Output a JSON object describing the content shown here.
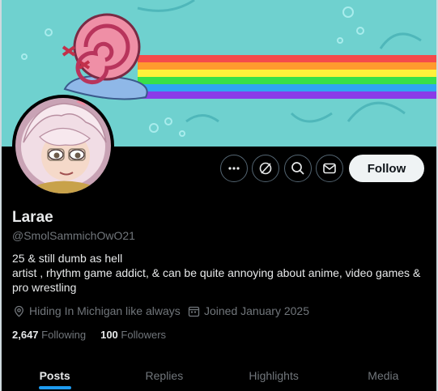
{
  "profile": {
    "display_name": "Larae",
    "handle": "@SmolSammichOwO21",
    "bio_line1": "25 & still dumb as hell",
    "bio_line2": "artist , rhythm game addict, & can be quite annoying about anime, video games & pro wrestling",
    "location": "Hiding In Michigan like always",
    "joined": "Joined January 2025"
  },
  "stats": {
    "following_count": "2,647",
    "following_label": "Following",
    "followers_count": "100",
    "followers_label": "Followers"
  },
  "actions": {
    "follow_label": "Follow",
    "more_icon": "more-icon",
    "grok_icon": "grok-icon",
    "search_icon": "search-icon",
    "message_icon": "message-icon"
  },
  "tabs": [
    {
      "label": "Posts",
      "active": true
    },
    {
      "label": "Replies",
      "active": false
    },
    {
      "label": "Highlights",
      "active": false
    },
    {
      "label": "Media",
      "active": false
    }
  ],
  "colors": {
    "background": "#000000",
    "primary_text": "#e7e9ea",
    "secondary_text": "#71767b",
    "accent": "#1d9bf0",
    "follow_button_bg": "#eff3f4",
    "banner_sky": "#6fd1cf"
  }
}
